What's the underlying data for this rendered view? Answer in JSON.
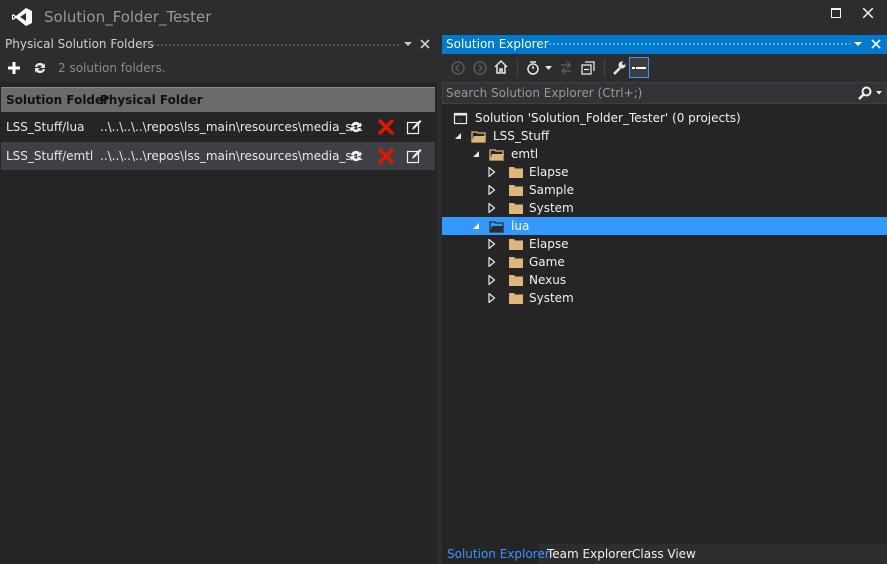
{
  "window": {
    "title": "Solution_Folder_Tester"
  },
  "left_panel": {
    "title": "Physical Solution Folders",
    "status": "2 solution folders.",
    "columns": [
      "Solution Folder",
      "Physical Folder"
    ],
    "rows": [
      {
        "solution_folder": "LSS_Stuff/lua",
        "physical_folder": "..\\..\\..\\..\\repos\\lss_main\\resources\\media_src"
      },
      {
        "solution_folder": "LSS_Stuff/emtl",
        "physical_folder": "..\\..\\..\\..\\repos\\lss_main\\resources\\media_src"
      }
    ]
  },
  "solution_explorer": {
    "title": "Solution Explorer",
    "search_placeholder": "Search Solution Explorer (Ctrl+;)",
    "tree": [
      {
        "label": "Solution 'Solution_Folder_Tester' (0 projects)",
        "type": "solution"
      },
      {
        "label": "LSS_Stuff",
        "type": "folder-open",
        "expanded": true
      },
      {
        "label": "emtl",
        "type": "folder-open",
        "expanded": true
      },
      {
        "label": "Elapse",
        "type": "folder",
        "expanded": false
      },
      {
        "label": "Sample",
        "type": "folder",
        "expanded": false
      },
      {
        "label": "System",
        "type": "folder",
        "expanded": false
      },
      {
        "label": "lua",
        "type": "folder-open",
        "expanded": true,
        "selected": true
      },
      {
        "label": "Elapse",
        "type": "folder",
        "expanded": false
      },
      {
        "label": "Game",
        "type": "folder",
        "expanded": false
      },
      {
        "label": "Nexus",
        "type": "folder",
        "expanded": false
      },
      {
        "label": "System",
        "type": "folder",
        "expanded": false
      }
    ],
    "bottom_tabs": [
      "Solution Explorer",
      "Team Explorer",
      "Class View"
    ],
    "active_tab": "Solution Explorer"
  },
  "colors": {
    "accent": "#007acc",
    "selection": "#3399ff",
    "folder": "#dcb67a",
    "delete": "#e51400"
  }
}
